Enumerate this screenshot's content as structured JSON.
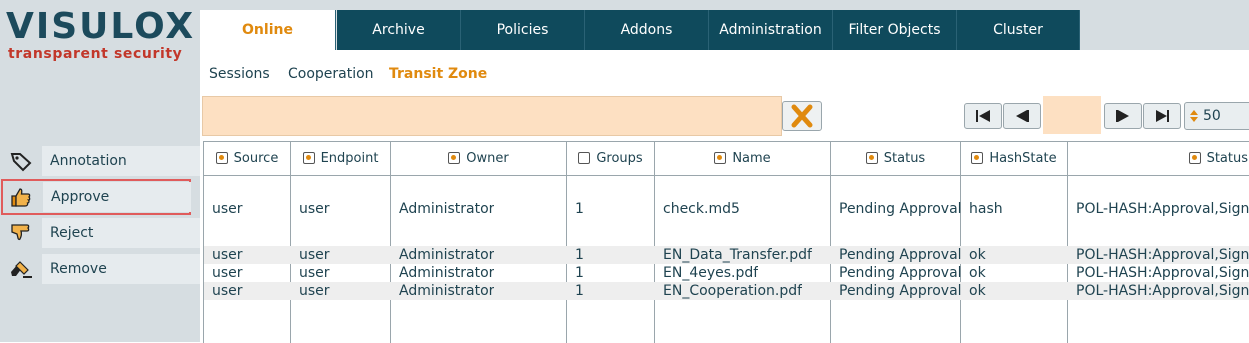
{
  "logo": {
    "title": "VISULOX",
    "subtitle": "transparent security"
  },
  "sidebar": {
    "actions": [
      {
        "label": "Annotation",
        "icon": "tag-icon"
      },
      {
        "label": "Approve",
        "icon": "thumbs-up-icon",
        "selected": true
      },
      {
        "label": "Reject",
        "icon": "thumbs-down-icon"
      },
      {
        "label": "Remove",
        "icon": "eraser-icon"
      }
    ]
  },
  "tabs": [
    "Online",
    "Archive",
    "Policies",
    "Addons",
    "Administration",
    "Filter Objects",
    "Cluster"
  ],
  "active_tab": "Online",
  "subtabs": [
    "Sessions",
    "Cooperation",
    "Transit Zone"
  ],
  "active_subtab": "Transit Zone",
  "filter": {
    "value": ""
  },
  "pager": {
    "page": "",
    "page_size": "50"
  },
  "table": {
    "headers": [
      {
        "label": "Source",
        "checked": true
      },
      {
        "label": "Endpoint",
        "checked": true
      },
      {
        "label": "Owner",
        "checked": true
      },
      {
        "label": "Groups",
        "checked": false
      },
      {
        "label": "Name",
        "checked": true
      },
      {
        "label": "Status",
        "checked": true
      },
      {
        "label": "HashState",
        "checked": true
      },
      {
        "label": "Status",
        "checked": true
      }
    ],
    "rows": [
      [
        "user",
        "user",
        "Administrator",
        "1",
        "check.md5",
        "Pending Approval",
        "hash",
        "POL-HASH:Approval,Signat"
      ],
      [
        "user",
        "user",
        "Administrator",
        "1",
        "EN_Data_Transfer.pdf",
        "Pending Approval",
        "ok",
        "POL-HASH:Approval,Signat"
      ],
      [
        "user",
        "user",
        "Administrator",
        "1",
        "EN_4eyes.pdf",
        "Pending Approval",
        "ok",
        "POL-HASH:Approval,Signat"
      ],
      [
        "user",
        "user",
        "Administrator",
        "1",
        "EN_Cooperation.pdf",
        "Pending Approval",
        "ok",
        "POL-HASH:Approval,Signat"
      ]
    ]
  },
  "colors": {
    "accent": "#e08a0f",
    "tab_bg": "#0f4a5c",
    "filter_bg": "#fde0c2",
    "selection_outline": "#e05b5b"
  }
}
